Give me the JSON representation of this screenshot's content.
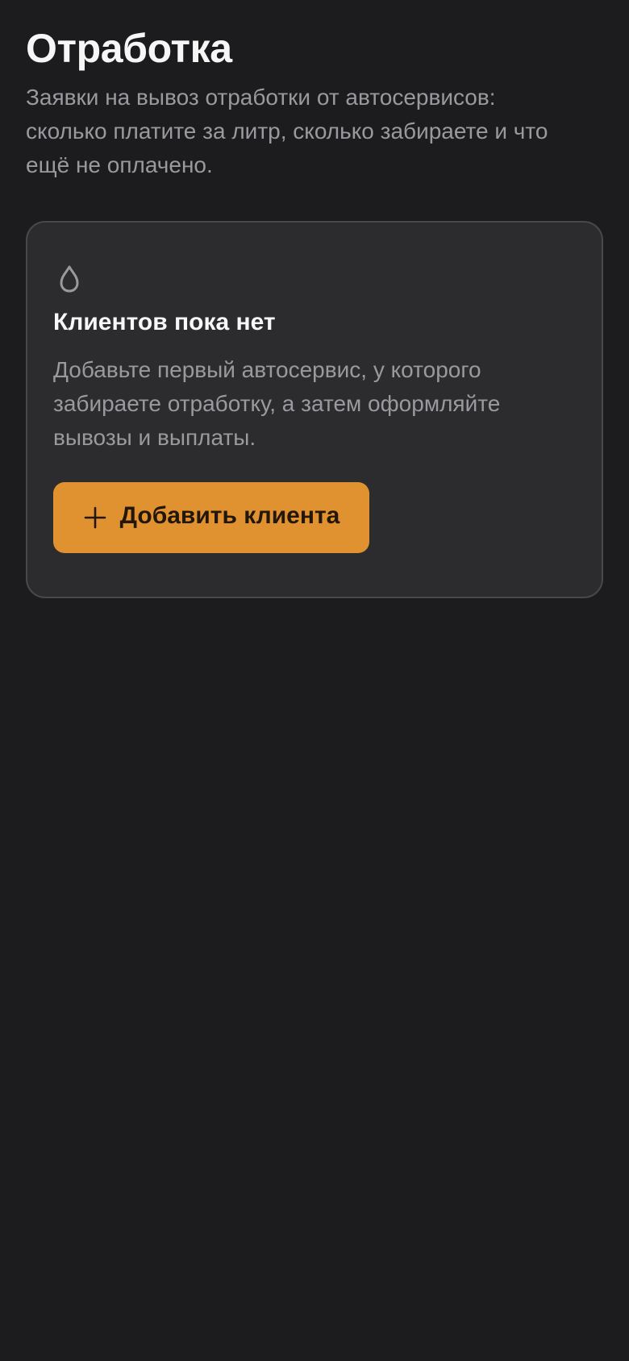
{
  "header": {
    "title": "Отработка",
    "subtitle": "Заявки на вывоз отработки от автосервисов: сколько платите за литр, сколько забираете и что ещё не оплачено."
  },
  "empty_state": {
    "icon": "oil-drop-icon",
    "title": "Клиентов пока нет",
    "text": "Добавьте первый автосервис, у которого забираете отработку, а затем оформляйте вывозы и выплаты.",
    "button": {
      "icon": "plus-icon",
      "label": "Добавить клиента"
    }
  },
  "colors": {
    "background": "#1c1c1e",
    "card": "#2c2c2e",
    "accent": "#e09230",
    "muted_text": "#9a9a9e"
  }
}
